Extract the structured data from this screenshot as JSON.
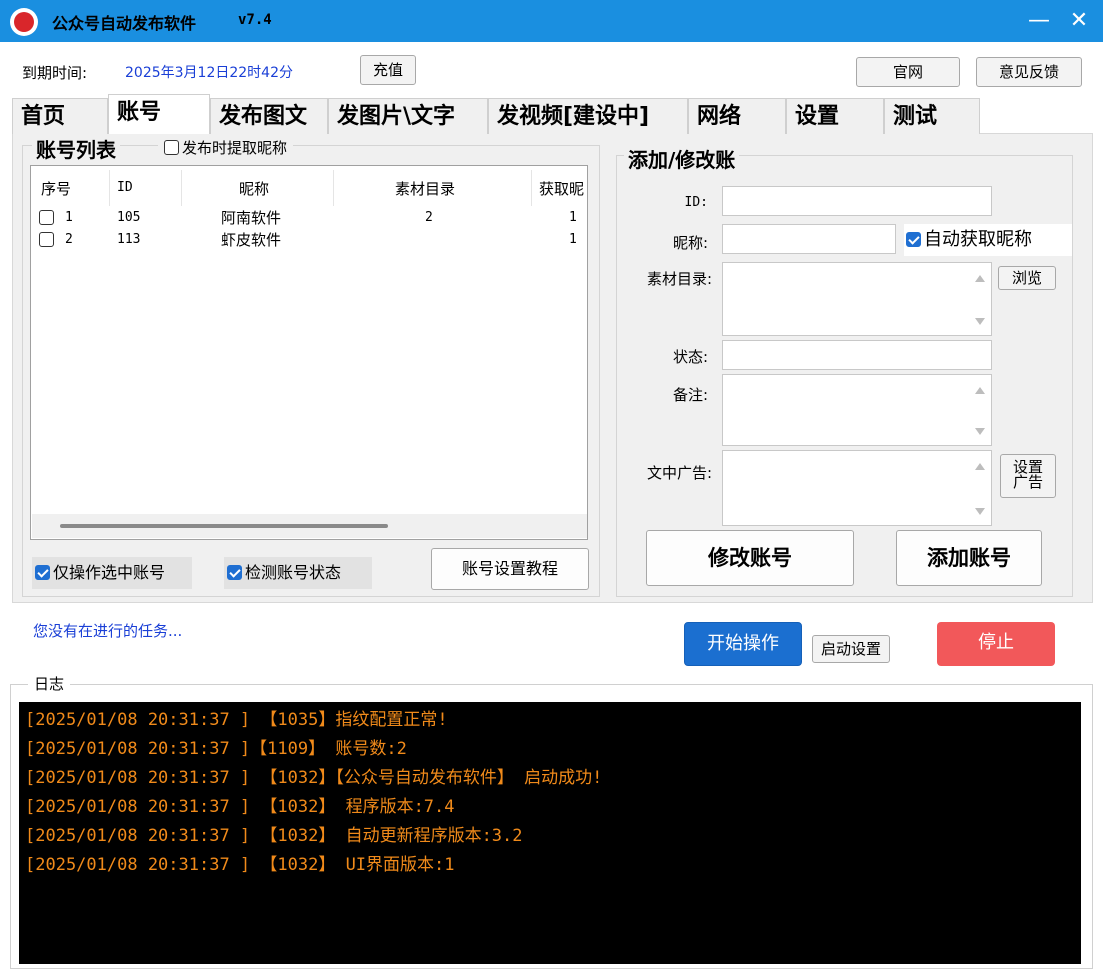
{
  "app": {
    "title": "公众号自动发布软件",
    "version": "v7.4",
    "minimize_icon": "minimize-icon",
    "close_icon": "close-icon"
  },
  "expire": {
    "label": "到期时间:",
    "value": "2025年3月12日22时42分",
    "recharge_label": "充值"
  },
  "header_buttons": {
    "official": "官网",
    "feedback": "意见反馈"
  },
  "tabs": [
    {
      "label": "首页"
    },
    {
      "label": "账号"
    },
    {
      "label": "发布图文"
    },
    {
      "label": "发图片\\文字"
    },
    {
      "label": "发视频[建设中]"
    },
    {
      "label": "网络"
    },
    {
      "label": "设置"
    },
    {
      "label": "测试"
    }
  ],
  "active_tab": "账号",
  "account_list": {
    "title": "账号列表",
    "extract_nickname_label": "发布时提取昵称",
    "extract_nickname_checked": false,
    "columns": [
      "序号",
      "ID",
      "昵称",
      "素材目录",
      "获取昵"
    ],
    "rows": [
      {
        "index": "1",
        "id": "105",
        "nickname": "阿南软件",
        "material": "2",
        "fetch": "1",
        "checked": false
      },
      {
        "index": "2",
        "id": "113",
        "nickname": "虾皮软件",
        "material": "",
        "fetch": "1",
        "checked": false
      }
    ],
    "only_selected_label": "仅操作选中账号",
    "only_selected_checked": true,
    "detect_status_label": "检测账号状态",
    "detect_status_checked": true,
    "tutorial_label": "账号设置教程"
  },
  "edit_form": {
    "title": "添加/修改账",
    "id_label": "ID:",
    "id_value": "",
    "nickname_label": "昵称:",
    "nickname_value": "",
    "auto_nick_label": "自动获取昵称",
    "auto_nick_checked": true,
    "material_label": "素材目录:",
    "material_value": "",
    "browse_label": "浏览",
    "status_label": "状态:",
    "status_value": "",
    "note_label": "备注:",
    "note_value": "",
    "ad_label": "文中广告:",
    "ad_value": "",
    "set_ad_label_1": "设置",
    "set_ad_label_2": "广告",
    "modify_label": "修改账号",
    "add_label": "添加账号"
  },
  "task": {
    "status": "您没有在进行的任务...",
    "start_label": "开始操作",
    "start_settings_label": "启动设置",
    "stop_label": "停止"
  },
  "log": {
    "title": "日志",
    "lines": [
      "[2025/01/08 20:31:37 ] 【1035】指纹配置正常!",
      "[2025/01/08 20:31:37 ]【1109】 账号数:2",
      "[2025/01/08 20:31:37 ] 【1032】【公众号自动发布软件】 启动成功!",
      "[2025/01/08 20:31:37 ] 【1032】 程序版本:7.4",
      "[2025/01/08 20:31:37 ] 【1032】 自动更新程序版本:3.2",
      "[2025/01/08 20:31:37 ] 【1032】 UI界面版本:1"
    ]
  },
  "colors": {
    "titlebar": "#1a8fe0",
    "link_blue": "#1a3fd6",
    "start_button": "#1b6fd0",
    "stop_button": "#f2585a",
    "log_text": "#f08a1a",
    "log_bg": "#000000"
  }
}
